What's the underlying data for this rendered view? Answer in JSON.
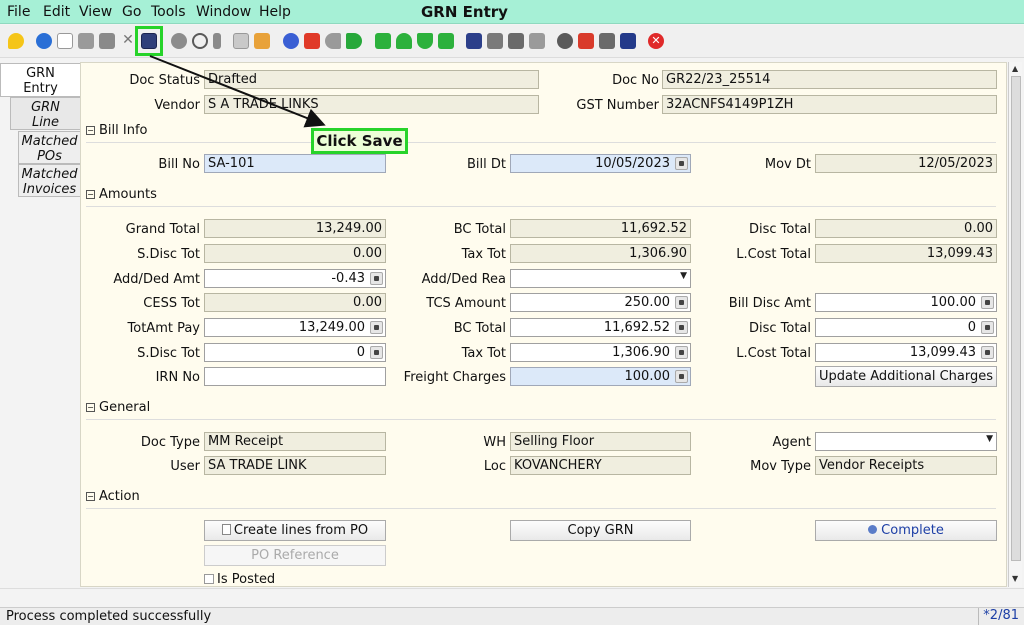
{
  "menu": {
    "items": [
      "File",
      "Edit",
      "View",
      "Go",
      "Tools",
      "Window",
      "Help"
    ],
    "title": "GRN Entry"
  },
  "toolbar": {
    "icons": [
      "undo-icon",
      "help-icon",
      "new-icon",
      "copy-icon",
      "delete-icon",
      "delete-selection-icon",
      "save-icon",
      "refresh-icon",
      "find-icon",
      "attachment-icon",
      "chat-icon",
      "history-icon",
      "home-icon",
      "home-parent-icon",
      "back-icon",
      "forward-icon",
      "first-icon",
      "previous-icon",
      "next-icon",
      "last-icon",
      "report-icon",
      "archive-icon",
      "print-icon",
      "print-preview-icon",
      "zoom-across-icon",
      "workflow-icon",
      "request-icon",
      "product-info-icon",
      "close-icon"
    ],
    "callout": "Click Save",
    "accent": "#27d32a"
  },
  "tabs": {
    "grn_entry": "GRN\nEntry",
    "grn_line": "GRN\nLine",
    "matched_pos": "Matched\nPOs",
    "matched_invoices": "Matched\nInvoices"
  },
  "header": {
    "doc_status_label": "Doc Status",
    "doc_status": "Drafted",
    "doc_no_label": "Doc No",
    "doc_no": "GR22/23_25514",
    "vendor_label": "Vendor",
    "vendor": "S A TRADE LINKS",
    "gst_label": "GST Number",
    "gst": "32ACNFS4149P1ZH"
  },
  "bill_info": {
    "title": "Bill Info",
    "bill_no_label": "Bill No",
    "bill_no": "SA-101",
    "bill_dt_label": "Bill Dt",
    "bill_dt": "10/05/2023",
    "mov_dt_label": "Mov Dt",
    "mov_dt": "12/05/2023"
  },
  "amounts": {
    "title": "Amounts",
    "grand_total_label": "Grand Total",
    "grand_total": "13,249.00",
    "bc_total_label": "BC Total",
    "bc_total": "11,692.52",
    "disc_total_label": "Disc Total",
    "disc_total": "0.00",
    "sdisc_tot_label": "S.Disc Tot",
    "sdisc_tot": "0.00",
    "tax_tot_label": "Tax Tot",
    "tax_tot": "1,306.90",
    "lcost_total_label": "L.Cost Total",
    "lcost_total": "13,099.43",
    "add_ded_amt_label": "Add/Ded Amt",
    "add_ded_amt": "-0.43",
    "add_ded_rea_label": "Add/Ded Rea",
    "add_ded_rea": "",
    "cess_tot_label": "CESS Tot",
    "cess_tot": "0.00",
    "tcs_amount_label": "TCS Amount",
    "tcs_amount": "250.00",
    "bill_disc_amt_label": "Bill Disc Amt",
    "bill_disc_amt": "100.00",
    "totamt_pay_label": "TotAmt Pay",
    "totamt_pay": "13,249.00",
    "bc_total2_label": "BC Total",
    "bc_total2": "11,692.52",
    "disc_total2_label": "Disc Total",
    "disc_total2": "0",
    "sdisc_tot2_label": "S.Disc Tot",
    "sdisc_tot2": "0",
    "tax_tot2_label": "Tax Tot",
    "tax_tot2": "1,306.90",
    "lcost_total2_label": "L.Cost Total",
    "lcost_total2": "13,099.43",
    "irn_no_label": "IRN No",
    "irn_no": "",
    "freight_label": "Freight Charges",
    "freight": "100.00",
    "update_btn": "Update Additional Charges"
  },
  "general": {
    "title": "General",
    "doc_type_label": "Doc Type",
    "doc_type": "MM Receipt",
    "wh_label": "WH",
    "wh": "Selling Floor",
    "agent_label": "Agent",
    "agent": "",
    "user_label": "User",
    "user": "SA TRADE LINK",
    "loc_label": "Loc",
    "loc": "KOVANCHERY",
    "mov_type_label": "Mov Type",
    "mov_type": "Vendor Receipts"
  },
  "action": {
    "title": "Action",
    "create_lines_btn": "Create lines from PO",
    "copy_grn_btn": "Copy GRN",
    "complete_btn": "Complete",
    "po_reference_btn": "PO Reference",
    "is_posted_label": "Is Posted"
  },
  "status": {
    "message": "Process completed successfully",
    "page": "*2/81"
  }
}
